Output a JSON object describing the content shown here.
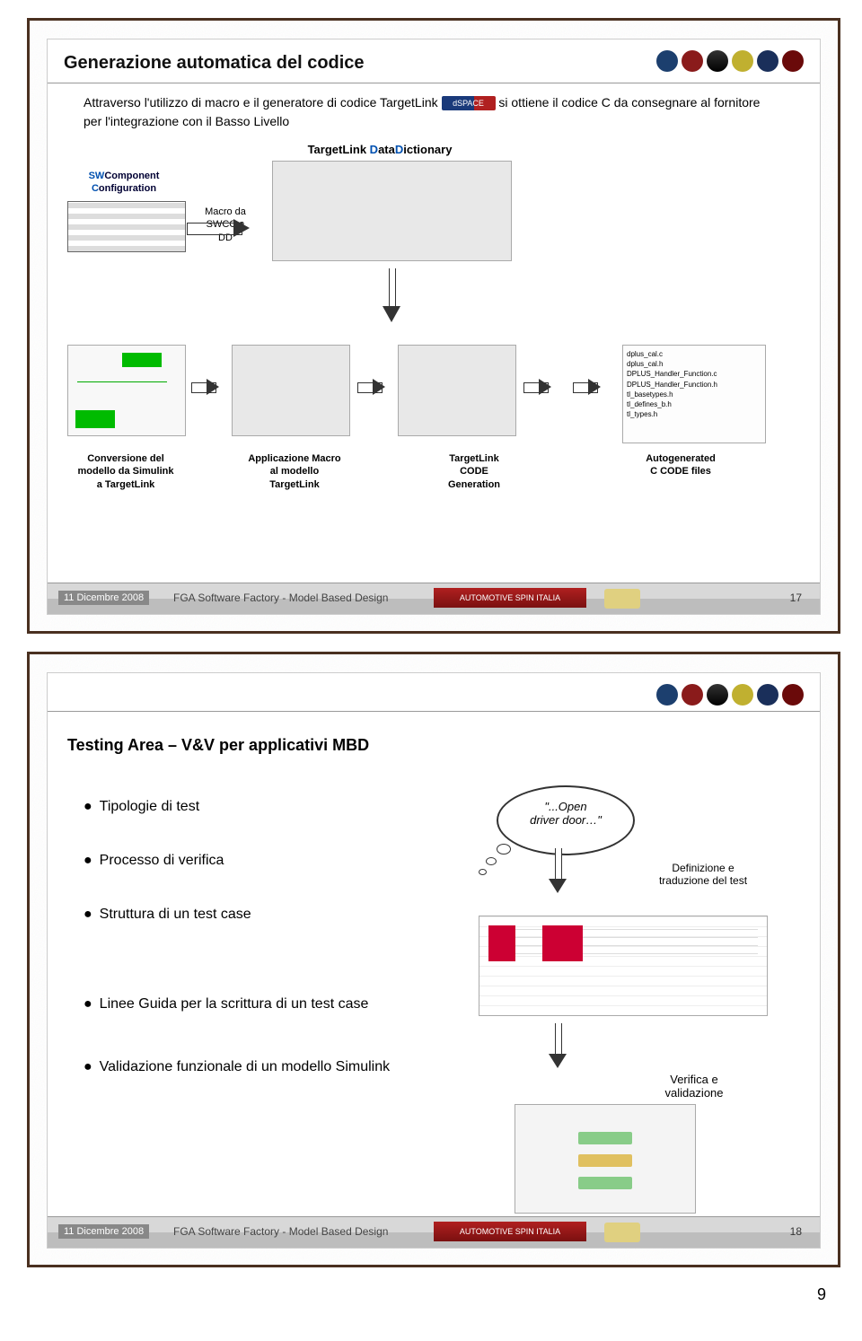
{
  "page_number": "9",
  "slide17": {
    "title": "Generazione automatica del codice",
    "intro_1": "Attraverso l'utilizzo di macro e il generatore di codice TargetLink ",
    "intro_ds": "dSPACE",
    "intro_2": " si ottiene il codice C da consegnare al fornitore per l'integrazione con il Basso Livello",
    "swcc_l1": "SWComponent",
    "swcc_l2": "Configuration",
    "macro1_l1": "Macro da",
    "macro1_l2": "SWCC a DD",
    "tldd_pre": "TargetLink ",
    "tldd_d1": "D",
    "tldd_mid": "ata",
    "tldd_d2": "D",
    "tldd_end": "ictionary",
    "conv_l1": "Conversione del",
    "conv_l2": "modello da Simulink",
    "conv_l3": "a TargetLink",
    "appm_l1": "Applicazione Macro",
    "appm_l2": "al modello",
    "appm_l3": "TargetLink",
    "tlcode_l1": "TargetLink",
    "tlcode_l2": "CODE",
    "tlcode_l3": "Generation",
    "autog_l1": "Autogenerated",
    "autog_l2": "C CODE files",
    "files": [
      "dplus_cal.c",
      "dplus_cal.h",
      "DPLUS_Handler_Function.c",
      "DPLUS_Handler_Function.h",
      "tl_basetypes.h",
      "tl_defines_b.h",
      "tl_types.h"
    ],
    "footer_date": "11 Dicembre 2008",
    "footer_txt": "FGA Software Factory - Model Based Design",
    "footer_band": "AUTOMOTIVE SPIN ITALIA",
    "footer_page": "17"
  },
  "slide18": {
    "title": "Testing Area – V&V per applicativi MBD",
    "b1": "Tipologie di test",
    "b2": "Processo di verifica",
    "b3": "Struttura di un test case",
    "b4": "Linee Guida per la scrittura di un test case",
    "b5": "Validazione funzionale di un modello Simulink",
    "cloud_l1": "\"...Open",
    "cloud_l2": "driver door…\"",
    "def_l1": "Definizione e",
    "def_l2": "traduzione del test",
    "ver_l1": "Verifica e",
    "ver_l2": "validazione",
    "footer_date": "11 Dicembre 2008",
    "footer_txt": "FGA Software Factory - Model Based Design",
    "footer_band": "AUTOMOTIVE SPIN ITALIA",
    "footer_page": "18"
  }
}
